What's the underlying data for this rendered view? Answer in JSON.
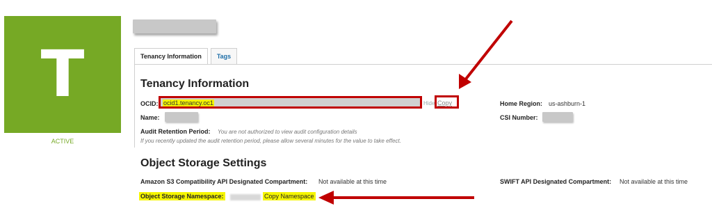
{
  "compartment": {
    "tile_letter": "T",
    "status": "ACTIVE",
    "colors": {
      "tile": "#76a925",
      "status_text": "#76a925"
    }
  },
  "tabs": [
    {
      "label": "Tenancy Information",
      "active": true
    },
    {
      "label": "Tags",
      "active": false
    }
  ],
  "tenancy_info": {
    "heading": "Tenancy Information",
    "ocid_label": "OCID:",
    "ocid_value": "ocid1.tenancy.oc1",
    "hide_link": "Hide",
    "copy_link": "Copy",
    "home_region_label": "Home Region:",
    "home_region_value": "us-ashburn-1",
    "name_label": "Name:",
    "csi_label": "CSI Number:",
    "audit_label": "Audit Retention Period:",
    "audit_value": "You are not authorized to view audit configuration details",
    "audit_note": "If you recently updated the audit retention period, please allow several minutes for the value to take effect."
  },
  "object_storage": {
    "heading": "Object Storage Settings",
    "s3_label": "Amazon S3 Compatibility API Designated Compartment:",
    "s3_value": "Not available at this time",
    "swift_label": "SWIFT API Designated Compartment:",
    "swift_value": "Not available at this time",
    "namespace_label": "Object Storage Namespace:",
    "copy_namespace": "Copy Namespace"
  },
  "annotation_colors": {
    "arrow": "#c00000",
    "highlight": "#f5f500",
    "redaction": "#c8c8c8"
  }
}
